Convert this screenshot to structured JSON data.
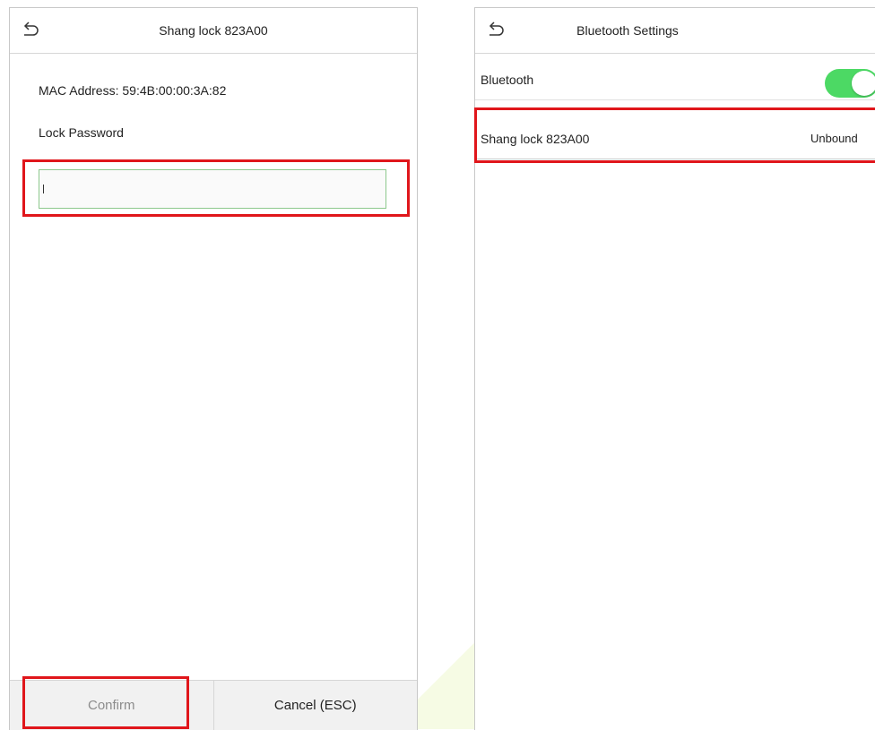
{
  "left_screen": {
    "title": "Shang lock 823A00",
    "mac_label": "MAC Address:",
    "mac_value": "59:4B:00:00:3A:82",
    "password_label": "Lock Password",
    "password_value": "",
    "confirm_label": "Confirm",
    "cancel_label": "Cancel (ESC)"
  },
  "right_screen": {
    "title": "Bluetooth Settings",
    "bluetooth_label": "Bluetooth",
    "bluetooth_enabled": true,
    "device_name": "Shang lock 823A00",
    "device_status": "Unbound"
  },
  "colors": {
    "highlight": "#e0161b",
    "toggle_on": "#4cd964",
    "field_border": "#8cc88c"
  },
  "icons": {
    "back": "back-arrow-icon"
  }
}
